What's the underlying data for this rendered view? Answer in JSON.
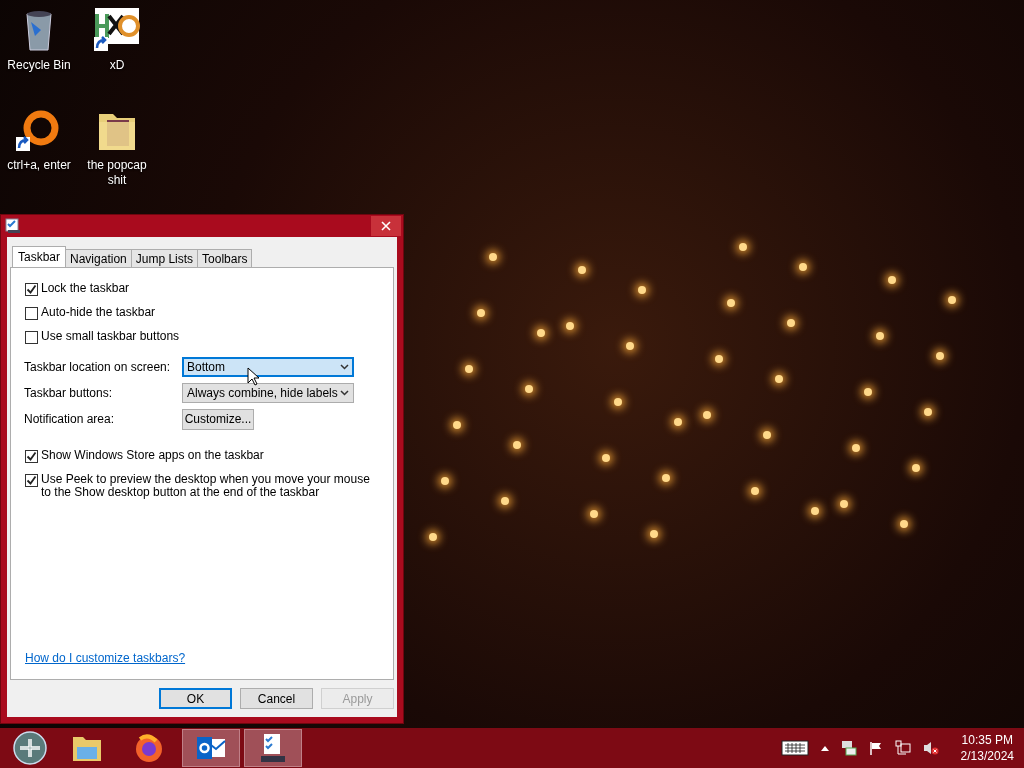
{
  "desktop_icons": [
    {
      "label": "Recycle Bin",
      "kind": "bin",
      "shortcut": false
    },
    {
      "label": "xD",
      "kind": "app",
      "shortcut": true
    },
    {
      "label": "ctrl+a, enter",
      "kind": "ring",
      "shortcut": true
    },
    {
      "label": "the popcap shit",
      "kind": "folder",
      "shortcut": false
    }
  ],
  "window": {
    "tabs": [
      {
        "label": "Taskbar",
        "selected": true
      },
      {
        "label": "Navigation",
        "selected": false
      },
      {
        "label": "Jump Lists",
        "selected": false
      },
      {
        "label": "Toolbars",
        "selected": false
      }
    ],
    "checkboxes_top": [
      {
        "label": "Lock the taskbar",
        "checked": true
      },
      {
        "label": "Auto-hide the taskbar",
        "checked": false
      },
      {
        "label": "Use small taskbar buttons",
        "checked": false
      }
    ],
    "settings": [
      {
        "label": "Taskbar location on screen:",
        "kind": "dropdown",
        "value": "Bottom",
        "focused": true
      },
      {
        "label": "Taskbar buttons:",
        "kind": "dropdown",
        "value": "Always combine, hide labels",
        "focused": false
      },
      {
        "label": "Notification area:",
        "kind": "button",
        "value": "Customize..."
      }
    ],
    "checkboxes_bottom": [
      {
        "label": "Show Windows Store apps on the taskbar",
        "checked": true
      },
      {
        "label": "Use Peek to preview the desktop when you move your mouse to the Show desktop button at the end of the taskbar",
        "checked": true
      }
    ],
    "help_link": "How do I customize taskbars?",
    "buttons": [
      {
        "label": "OK",
        "default": true,
        "disabled": false
      },
      {
        "label": "Cancel",
        "default": false,
        "disabled": false
      },
      {
        "label": "Apply",
        "default": false,
        "disabled": true
      }
    ]
  },
  "taskbar": {
    "apps": [
      {
        "kind": "explorer",
        "running": false
      },
      {
        "kind": "firefox",
        "running": false
      },
      {
        "kind": "mail",
        "running": true
      },
      {
        "kind": "checklist",
        "running": true
      }
    ],
    "tray": {
      "time": "10:35 PM",
      "date": "2/13/2024"
    }
  }
}
